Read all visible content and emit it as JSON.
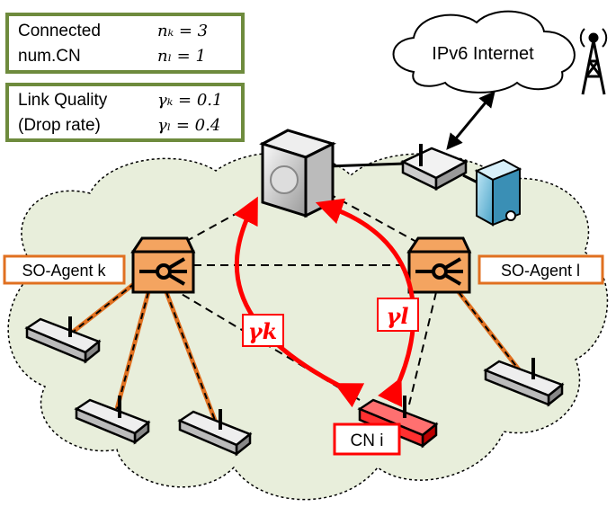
{
  "legend": {
    "connected": {
      "label_line1": "Connected",
      "label_line2": "num.CN",
      "nk": "nₖ = 3",
      "nl": "nₗ = 1"
    },
    "quality": {
      "label_line1": "Link Quality",
      "label_line2": "(Drop rate)",
      "gk": "γₖ = 0.1",
      "gl": "γₗ = 0.4"
    }
  },
  "internet_label": "IPv6 Internet",
  "agent_k_label": "SO-Agent k",
  "agent_l_label": "SO-Agent l",
  "cn_label": "CN i",
  "gamma_k": "γk",
  "gamma_l": "γl",
  "colors": {
    "legend_border": "#6e8b3d",
    "agent": "#f4a460",
    "agent_border": "#e07020",
    "link": "#ff0000",
    "cloud": "#e8eedb",
    "cn": "#ff4040"
  }
}
